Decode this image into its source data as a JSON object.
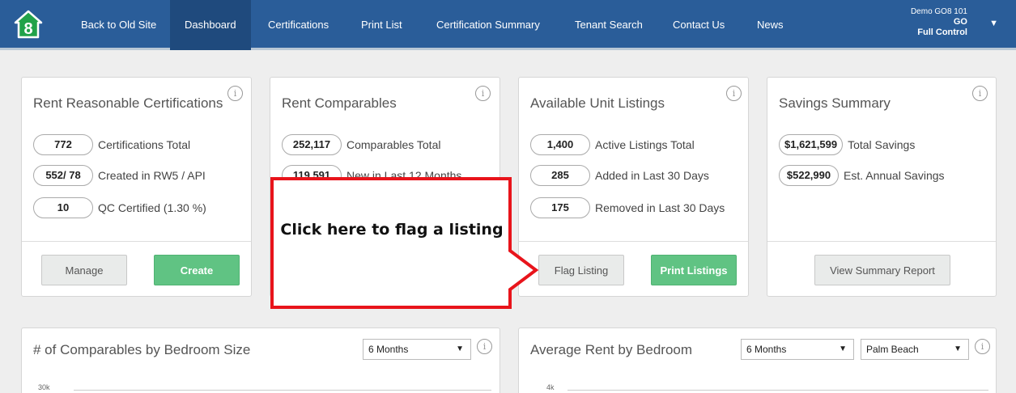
{
  "nav": {
    "items": [
      "Back to Old Site",
      "Dashboard",
      "Certifications",
      "Print List",
      "Certification Summary",
      "Tenant Search",
      "Contact Us",
      "News"
    ],
    "active_index": 1
  },
  "user": {
    "account": "Demo GO8 101",
    "org": "GO",
    "role": "Full Control"
  },
  "cards": {
    "rent_reasonable": {
      "title": "Rent Reasonable Certifications",
      "stats": [
        {
          "value": "772",
          "label": "Certifications Total"
        },
        {
          "value": "552/ 78",
          "label": "Created in RW5 / API"
        },
        {
          "value": "10",
          "label": "QC Certified (1.30 %)"
        }
      ],
      "manage_label": "Manage",
      "create_label": "Create"
    },
    "rent_comparables": {
      "title": "Rent Comparables",
      "stats": [
        {
          "value": "252,117",
          "label": "Comparables Total"
        },
        {
          "value": "119,591",
          "label": "New in Last 12 Months"
        }
      ]
    },
    "available_units": {
      "title": "Available Unit Listings",
      "stats": [
        {
          "value": "1,400",
          "label": "Active Listings Total"
        },
        {
          "value": "285",
          "label": "Added in Last 30 Days"
        },
        {
          "value": "175",
          "label": "Removed in Last 30 Days"
        }
      ],
      "flag_label": "Flag Listing",
      "print_label": "Print Listings"
    },
    "savings": {
      "title": "Savings Summary",
      "stats": [
        {
          "value": "$1,621,599",
          "label": "Total Savings"
        },
        {
          "value": "$522,990",
          "label": "Est. Annual Savings"
        }
      ],
      "report_label": "View Summary Report"
    }
  },
  "charts": {
    "comparables_by_bedroom": {
      "title": "# of Comparables by Bedroom Size",
      "period": "6 Months",
      "top_tick": "30k"
    },
    "avg_rent_by_bedroom": {
      "title": "Average Rent by Bedroom",
      "period": "6 Months",
      "region": "Palm Beach",
      "top_tick": "4k"
    }
  },
  "callout": {
    "text": "Click here to flag a listing"
  },
  "colors": {
    "nav_bg": "#2a5d99",
    "nav_active": "#1f4a7d",
    "green_button": "#60c383",
    "callout_border": "#e8141b"
  }
}
